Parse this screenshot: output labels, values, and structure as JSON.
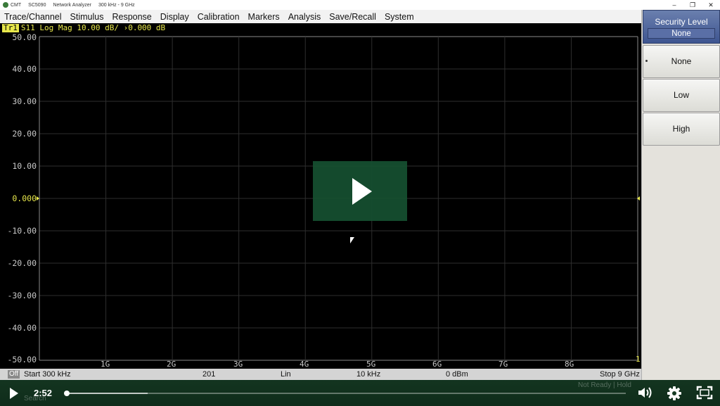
{
  "window": {
    "title_parts": [
      "CMT",
      "SC5090",
      "Network Analyzer",
      "300 kHz - 9 GHz"
    ],
    "controls": {
      "minimize": "–",
      "restore": "❐",
      "close": "✕"
    }
  },
  "menu": [
    "Trace/Channel",
    "Stimulus",
    "Response",
    "Display",
    "Calibration",
    "Markers",
    "Analysis",
    "Save/Recall",
    "System"
  ],
  "trace": {
    "badge": "Tr1",
    "text": "S11 Log Mag 10.00 dB/ ›0.000 dB",
    "color": "#e8e84c"
  },
  "plot": {
    "y_ticks": [
      "50.00",
      "40.00",
      "30.00",
      "20.00",
      "10.00",
      "0.000",
      "-10.00",
      "-20.00",
      "-30.00",
      "-40.00",
      "-50.00"
    ],
    "x_ticks": [
      "1G",
      "2G",
      "3G",
      "4G",
      "5G",
      "6G",
      "7G",
      "8G"
    ],
    "end_marker": "1",
    "reference_value": "0.000"
  },
  "status": {
    "off_badge": "Off",
    "start": "Start 300 kHz",
    "points": "201",
    "sweep_type": "Lin",
    "ifbw": "10 kHz",
    "power": "0 dBm",
    "stop": "Stop 9 GHz"
  },
  "panel": {
    "title": "Security Level",
    "current": "None",
    "options": [
      "None",
      "Low",
      "High"
    ],
    "selected_index": 0,
    "header_color": "#3e5590"
  },
  "video": {
    "time": "2:52",
    "progress": 0.0,
    "buffered": 0.147,
    "ghost_status": "Not Ready | Hold",
    "ghost_search": "Search",
    "accent": "#163c24"
  }
}
